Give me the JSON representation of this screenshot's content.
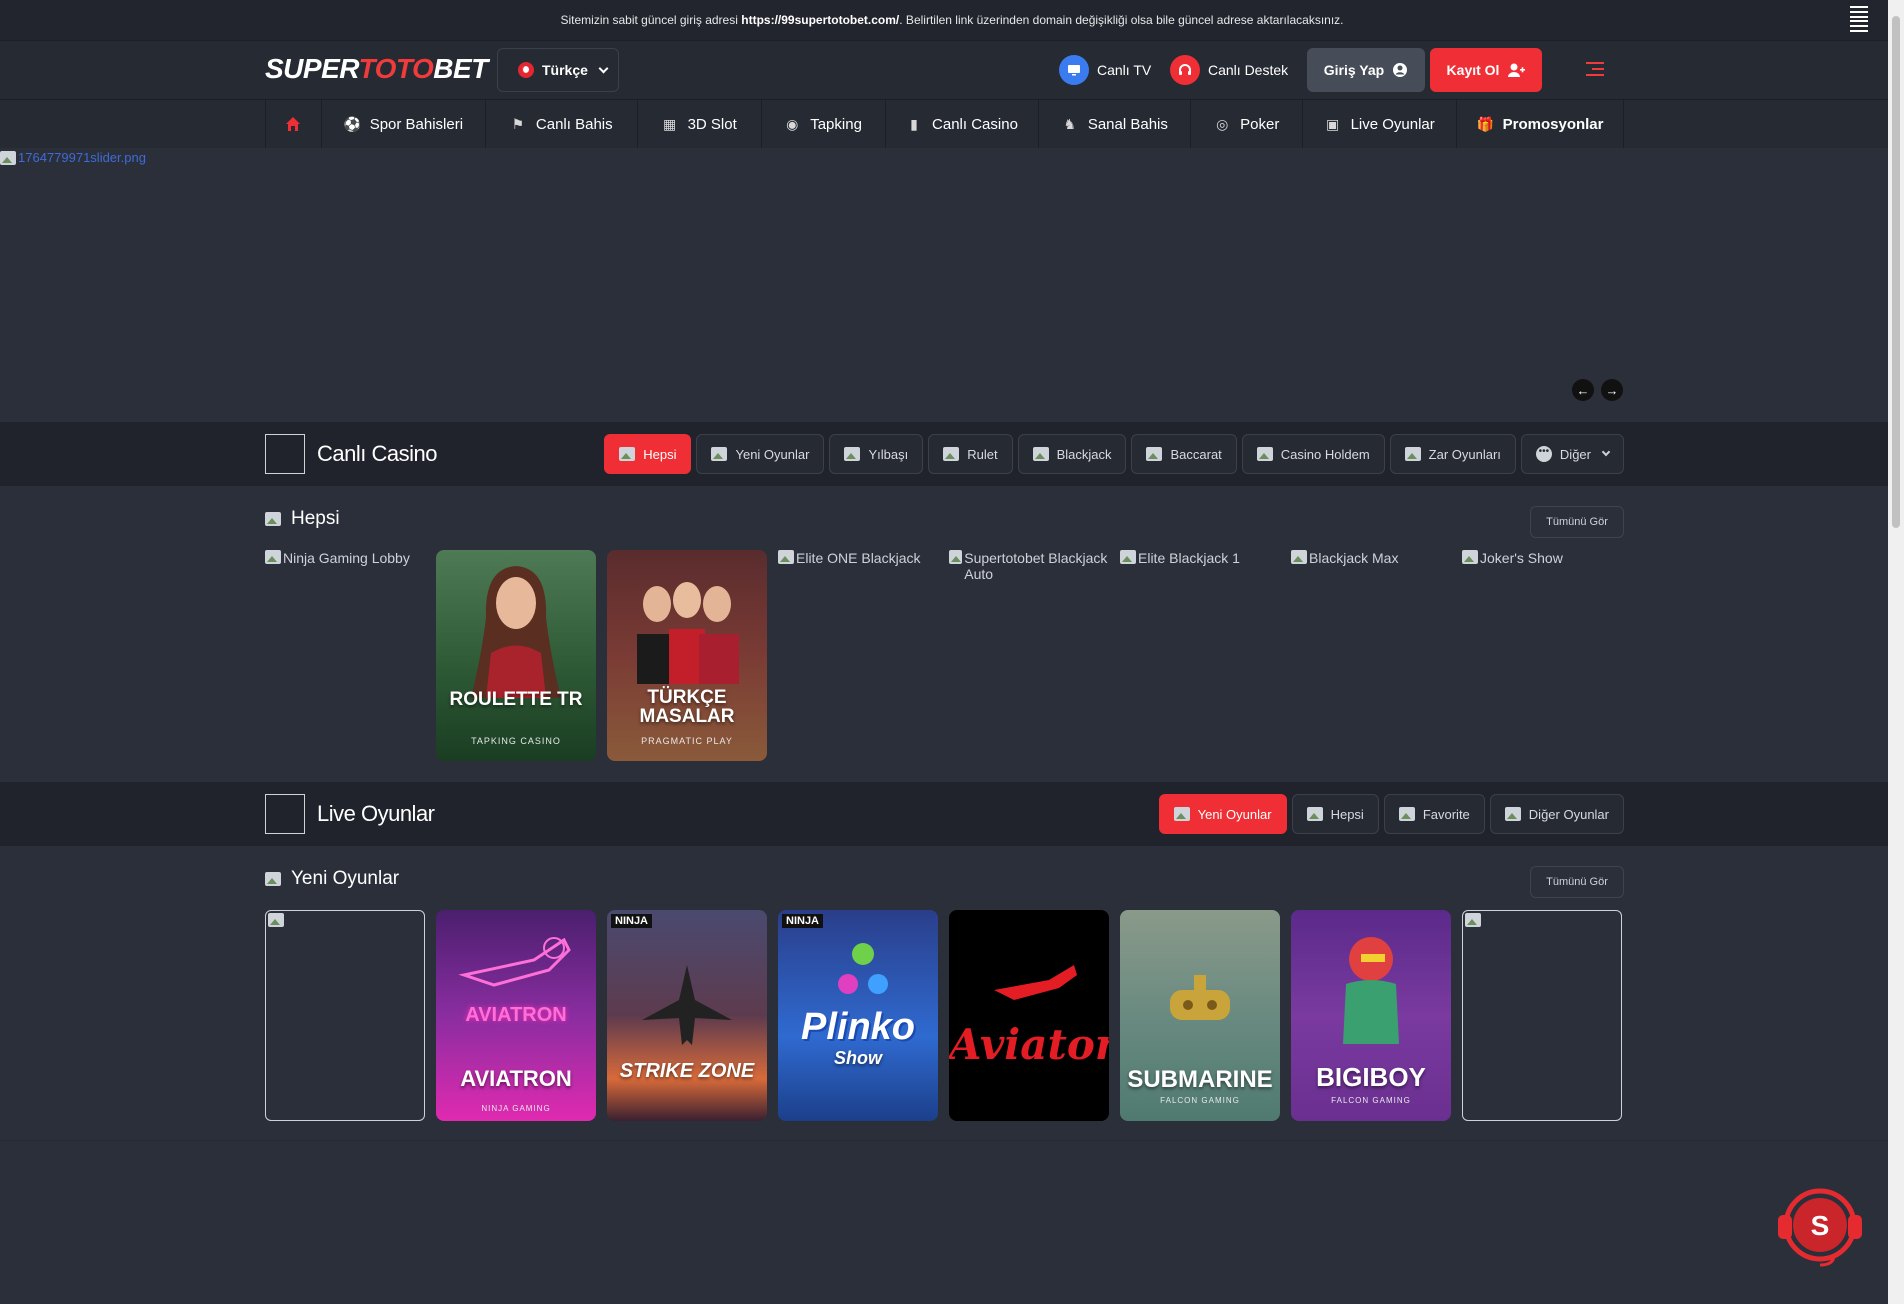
{
  "announcement": {
    "prefix": "Sitemizin sabit güncel giriş adresi",
    "url": "https://99supertotobet.com/",
    "suffix": ". Belirtilen link üzerinden domain değişikliği olsa bile güncel adrese aktarılacaksınız."
  },
  "header": {
    "logo_white": "SUPER",
    "logo_red": "TOTO",
    "logo_white2": "BET",
    "language": "Türkçe",
    "live_tv": "Canlı TV",
    "live_support": "Canlı Destek",
    "login": "Giriş Yap",
    "register": "Kayıt Ol"
  },
  "nav": [
    {
      "label": "",
      "icon": "home-icon"
    },
    {
      "label": "Spor Bahisleri",
      "icon": "soccer-ball-icon"
    },
    {
      "label": "Canlı Bahis",
      "icon": "live-bet-icon"
    },
    {
      "label": "3D Slot",
      "icon": "slot-icon"
    },
    {
      "label": "Tapking",
      "icon": "tapking-icon"
    },
    {
      "label": "Canlı Casino",
      "icon": "cards-icon"
    },
    {
      "label": "Sanal Bahis",
      "icon": "virtual-bet-icon"
    },
    {
      "label": "Poker",
      "icon": "poker-chip-icon"
    },
    {
      "label": "Live Oyunlar",
      "icon": "live-games-icon"
    },
    {
      "label": "Promosyonlar",
      "icon": "gift-icon"
    }
  ],
  "slider": {
    "broken_alt": "1764779971slider.png"
  },
  "live_casino": {
    "title": "Canlı Casino",
    "chips": [
      "Hepsi",
      "Yeni Oyunlar",
      "Yılbaşı",
      "Rulet",
      "Blackjack",
      "Baccarat",
      "Casino Holdem",
      "Zar Oyunları",
      "Diğer"
    ],
    "sub_title": "Hepsi",
    "see_all": "Tümünü Gör",
    "games": [
      {
        "alt": "Ninja Gaming Lobby"
      },
      {
        "title": "ROULETTE TR",
        "provider": "TAPKING CASINO"
      },
      {
        "title": "TÜRKÇE MASALAR",
        "provider": "PRAGMATIC PLAY"
      },
      {
        "alt": "Elite ONE Blackjack"
      },
      {
        "alt": "Supertotobet Blackjack Auto"
      },
      {
        "alt": "Elite Blackjack 1"
      },
      {
        "alt": "Blackjack Max"
      },
      {
        "alt": "Joker's Show"
      }
    ]
  },
  "live_games": {
    "title": "Live Oyunlar",
    "chips": [
      "Yeni Oyunlar",
      "Hepsi",
      "Favorite",
      "Diğer Oyunlar"
    ],
    "sub_title": "Yeni Oyunlar",
    "see_all": "Tümünü Gör",
    "games": [
      {
        "title": ""
      },
      {
        "title": "AVIATRON",
        "logo": "AVIATRON",
        "provider": "NINJA GAMING"
      },
      {
        "title": "STRIKE ZONE",
        "badge": "NINJA"
      },
      {
        "title": "Plinko",
        "sub": "Show",
        "badge": "NINJA"
      },
      {
        "title": "Aviator"
      },
      {
        "title": "SUBMARINE",
        "provider": "FALCON GAMING"
      },
      {
        "title": "BIGIBOY",
        "provider": "FALCON GAMING"
      },
      {
        "title": ""
      }
    ]
  }
}
